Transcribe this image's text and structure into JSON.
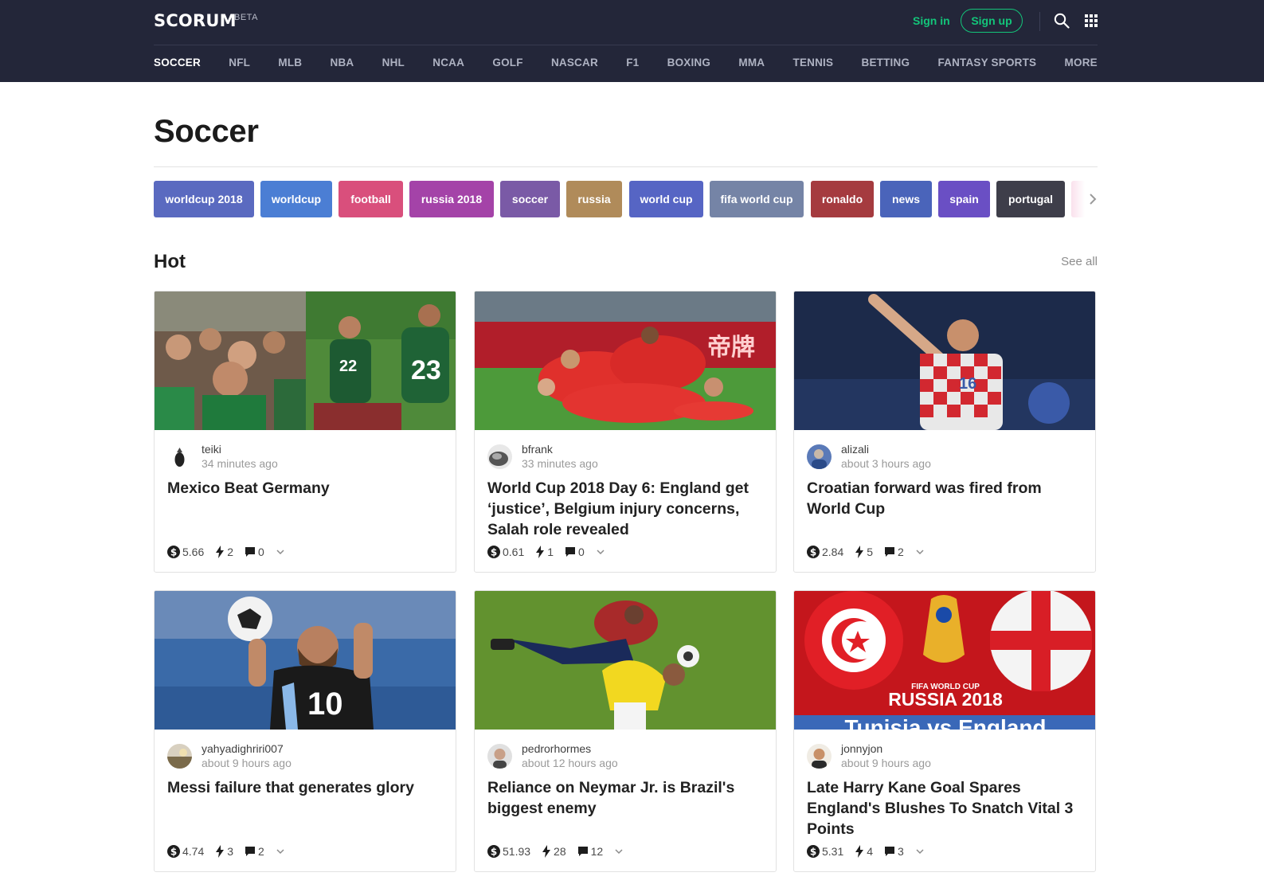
{
  "header": {
    "logo": "SCORUM",
    "beta": "BETA",
    "sign_in": "Sign in",
    "sign_up": "Sign up",
    "nav": [
      "SOCCER",
      "NFL",
      "MLB",
      "NBA",
      "NHL",
      "NCAA",
      "GOLF",
      "NASCAR",
      "F1",
      "BOXING",
      "MMA",
      "TENNIS",
      "BETTING",
      "FANTASY SPORTS",
      "MORE"
    ],
    "active_nav": "SOCCER",
    "accent_color": "#13c57a",
    "background_color": "#232639"
  },
  "page": {
    "title": "Soccer"
  },
  "tags": [
    {
      "label": "worldcup 2018",
      "color": "#5a6ac0"
    },
    {
      "label": "worldcup",
      "color": "#4b7ed4"
    },
    {
      "label": "football",
      "color": "#d94f7c"
    },
    {
      "label": "russia 2018",
      "color": "#a443a8"
    },
    {
      "label": "soccer",
      "color": "#7a5aa6"
    },
    {
      "label": "russia",
      "color": "#b08b5a"
    },
    {
      "label": "world cup",
      "color": "#5665c4"
    },
    {
      "label": "fifa world cup",
      "color": "#7584a6"
    },
    {
      "label": "ronaldo",
      "color": "#a53b3f"
    },
    {
      "label": "news",
      "color": "#4a64ba"
    },
    {
      "label": "spain",
      "color": "#6a4fc4"
    },
    {
      "label": "portugal",
      "color": "#3e3e4a"
    }
  ],
  "hot": {
    "title": "Hot",
    "see_all": "See all",
    "cards": [
      {
        "author": "teiki",
        "time": "34 minutes ago",
        "title": "Mexico Beat Germany",
        "payout": "5.66",
        "votes": "2",
        "comments": "0"
      },
      {
        "author": "bfrank",
        "time": "33 minutes ago",
        "title": "World Cup 2018 Day 6: England get ‘justice’, Belgium injury concerns, Salah role revealed",
        "payout": "0.61",
        "votes": "1",
        "comments": "0"
      },
      {
        "author": "alizali",
        "time": "about 3 hours ago",
        "title": "Croatian forward was fired from World Cup",
        "payout": "2.84",
        "votes": "5",
        "comments": "2"
      },
      {
        "author": "yahyadighriri007",
        "time": "about 9 hours ago",
        "title": "Messi failure that generates glory",
        "payout": "4.74",
        "votes": "3",
        "comments": "2"
      },
      {
        "author": "pedrorhormes",
        "time": "about 12 hours ago",
        "title": "Reliance on Neymar Jr. is Brazil's biggest enemy",
        "payout": "51.93",
        "votes": "28",
        "comments": "12"
      },
      {
        "author": "jonnyjon",
        "time": "about 9 hours ago",
        "title": "Late Harry Kane Goal Spares England's Blushes To Snatch Vital 3 Points",
        "payout": "5.31",
        "votes": "4",
        "comments": "3"
      }
    ]
  },
  "images": {
    "jerseys": [
      "22",
      "23",
      "16",
      "10"
    ],
    "sponsor": "帝牌",
    "banner_top": "FIFA WORLD CUP",
    "banner_main": "RUSSIA 2018",
    "banner_sub": "Tunisia vs England"
  },
  "icons": {
    "search": "search-icon",
    "apps": "apps-grid-icon",
    "next": "chevron-right-icon",
    "payout": "dollar-icon",
    "votes": "lightning-icon",
    "comments": "comment-icon",
    "more": "chevron-down-icon"
  }
}
